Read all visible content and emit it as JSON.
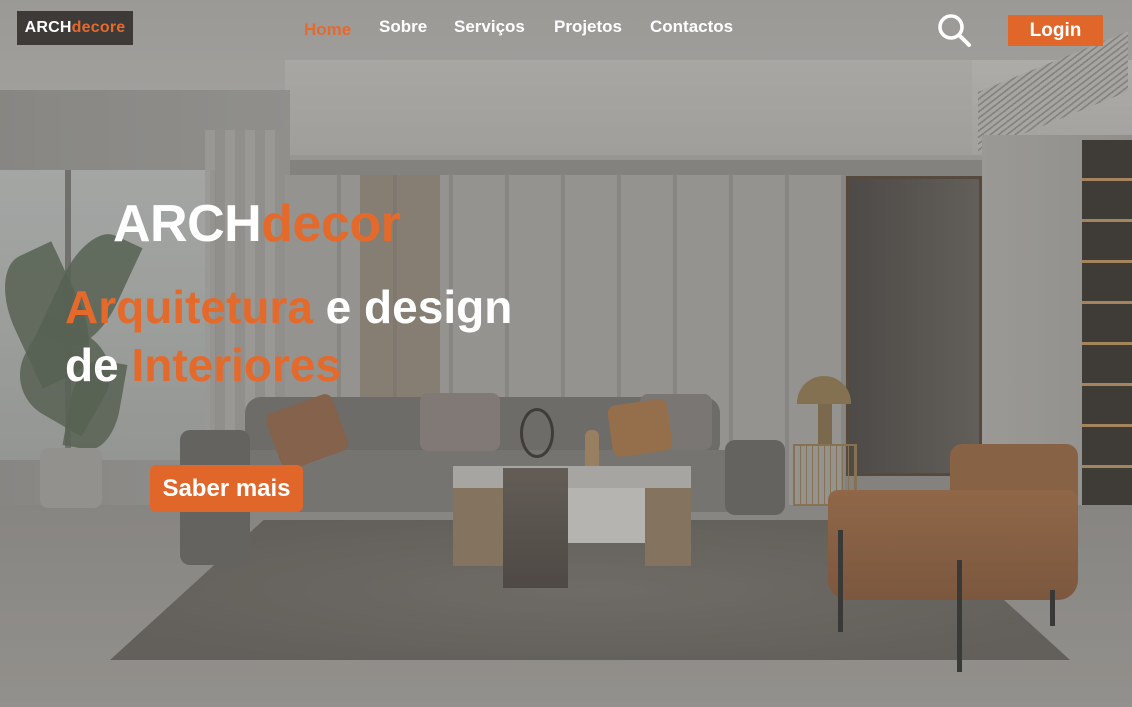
{
  "header": {
    "logo": {
      "part1": "ARCH",
      "part2": "decore"
    },
    "nav": [
      {
        "label": "Home",
        "active": true
      },
      {
        "label": "Sobre",
        "active": false
      },
      {
        "label": "Serviços",
        "active": false
      },
      {
        "label": "Projetos",
        "active": false
      },
      {
        "label": "Contactos",
        "active": false
      }
    ],
    "search_icon": "search-icon",
    "login_label": "Login"
  },
  "hero": {
    "brand": {
      "part1": "ARCH",
      "part2": "decor"
    },
    "headline": {
      "line1_accent": "Arquitetura",
      "line1_rest": " e design",
      "line2_prefix": "de ",
      "line2_accent": "Interiores"
    },
    "cta_label": "Saber mais"
  },
  "colors": {
    "accent": "#e56a2e",
    "logo_bg": "#3d3a38",
    "text": "#ffffff"
  }
}
